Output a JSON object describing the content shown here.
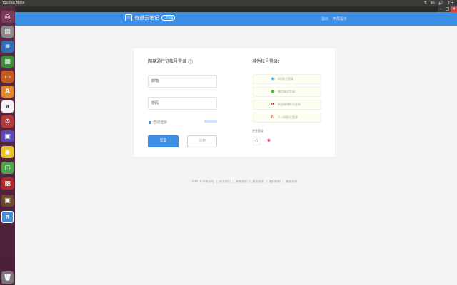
{
  "topbar": {
    "window_title": "Youdao Note",
    "time": "下午",
    "tray": [
      "⇅",
      "✉",
      "🔊"
    ]
  },
  "window_controls": {
    "minimize": "–",
    "maximize": "□",
    "close": "✕"
  },
  "header": {
    "brand_logo": "n",
    "brand_name": "有道云笔记",
    "brand_badge": "Linux",
    "links": [
      "退出",
      "不再提示"
    ]
  },
  "login": {
    "title": "网易通行证帐号登录",
    "help_glyph": "?",
    "username_placeholder": "邮箱",
    "password_placeholder": "密码",
    "remember_label": "自动登录",
    "login_button": "登录",
    "register_button": "注册"
  },
  "third_party": {
    "title": "其他帐号登录：",
    "providers": [
      {
        "glyph": "◉",
        "color": "#1ca1f2",
        "label": "QQ帐号登录"
      },
      {
        "glyph": "●",
        "color": "#3fbe3a",
        "label": "微信帐号登录"
      },
      {
        "glyph": "✿",
        "color": "#e6162d",
        "label": "新浪微博帐号登录"
      },
      {
        "glyph": "R",
        "color": "#d9301c",
        "label": "人人网帐号登录"
      }
    ],
    "more_label": "更多登录",
    "more_icons": [
      {
        "glyph": "G",
        "color": "#999999"
      },
      {
        "glyph": "✾",
        "color": "#e6162d"
      }
    ]
  },
  "footer": {
    "links": [
      "©2016 网易公司",
      "关于我们",
      "联系我们",
      "意见反馈",
      "使用帮助",
      "服务条款"
    ]
  },
  "launcher": [
    {
      "name": "ubuntu-dash-icon",
      "glyph": "◎",
      "bg": "#7a3a5a"
    },
    {
      "name": "files-icon",
      "glyph": "▤",
      "bg": "#8a8a8a"
    },
    {
      "name": "writer-icon",
      "glyph": "≡",
      "bg": "#2f6fb7"
    },
    {
      "name": "calc-icon",
      "glyph": "▦",
      "bg": "#3a8d3a"
    },
    {
      "name": "impress-icon",
      "glyph": "▭",
      "bg": "#c85a1a"
    },
    {
      "name": "software-center-icon",
      "glyph": "A",
      "bg": "#e08a2a"
    },
    {
      "name": "amazon-icon",
      "glyph": "a",
      "bg": "#f2f2f2"
    },
    {
      "name": "settings-icon",
      "glyph": "⚙",
      "bg": "#b63a3a"
    },
    {
      "name": "bundle-icon",
      "glyph": "▣",
      "bg": "#5a4ab7"
    },
    {
      "name": "chrome-icon",
      "glyph": "◉",
      "bg": "#e8c22a"
    },
    {
      "name": "messaging-icon",
      "glyph": "▢",
      "bg": "#4aa84a"
    },
    {
      "name": "image-viewer-icon",
      "glyph": "▩",
      "bg": "#b02a2a"
    },
    {
      "name": "photo-icon",
      "glyph": "▣",
      "bg": "#6b4a2a"
    },
    {
      "name": "youdao-note-icon",
      "glyph": "n",
      "bg": "#3d8fe6"
    },
    {
      "name": "trash-icon",
      "glyph": "🗑",
      "bg": "#777777"
    }
  ]
}
